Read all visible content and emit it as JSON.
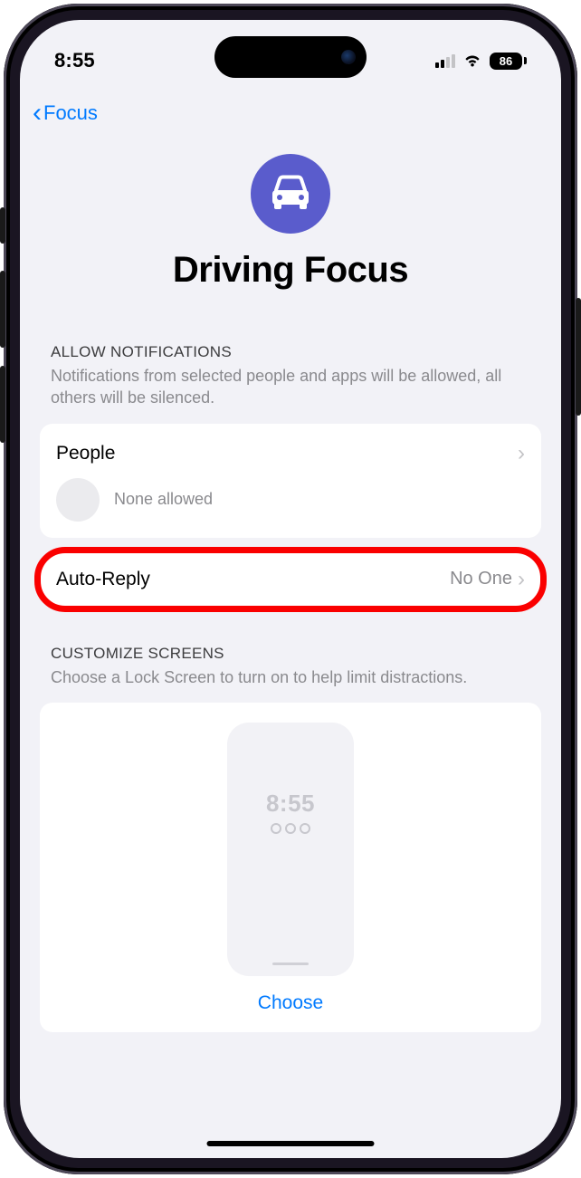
{
  "status": {
    "time": "8:55",
    "battery": "86"
  },
  "nav": {
    "back_label": "Focus"
  },
  "header": {
    "title": "Driving Focus"
  },
  "notifications": {
    "section_title": "ALLOW NOTIFICATIONS",
    "section_sub": "Notifications from selected people and apps will be allowed, all others will be silenced.",
    "people_label": "People",
    "people_status": "None allowed",
    "auto_reply_label": "Auto-Reply",
    "auto_reply_value": "No One"
  },
  "screens": {
    "section_title": "CUSTOMIZE SCREENS",
    "section_sub": "Choose a Lock Screen to turn on to help limit distractions.",
    "preview_time": "8:55",
    "choose_label": "Choose"
  },
  "annotation": {
    "highlight_row": "auto-reply"
  },
  "colors": {
    "accent": "#007aff",
    "icon_bg": "#5a5ccc",
    "highlight": "#fa0000"
  }
}
